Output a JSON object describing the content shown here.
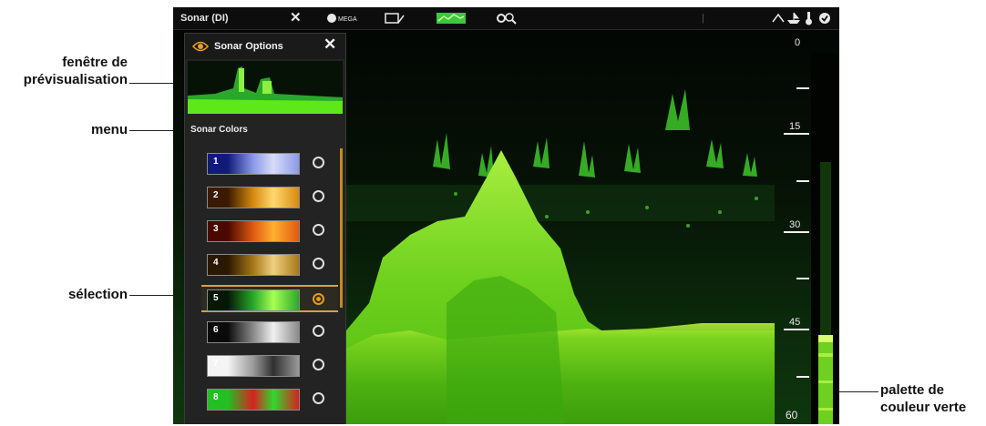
{
  "topbar": {
    "title": "Sonar (DI)",
    "close_glyph": "✕",
    "mega_label": "MEGA",
    "icons": [
      "close-icon",
      "mega-icon",
      "split-view-icon",
      "sonar-view-icon",
      "settings-search-icon",
      "gps-icon",
      "boat-icon",
      "temperature-icon",
      "check-icon"
    ]
  },
  "options": {
    "title": "Sonar Options",
    "close_glyph": "✕",
    "section": "Sonar Colors",
    "palettes": [
      {
        "num": "1",
        "colors": [
          "#101a7a",
          "#8a9ae8",
          "#d8dcf8"
        ],
        "selected": false
      },
      {
        "num": "2",
        "colors": [
          "#3a1a00",
          "#d88a10",
          "#ffd870"
        ],
        "selected": false
      },
      {
        "num": "3",
        "colors": [
          "#4a0800",
          "#e05a10",
          "#ffb030"
        ],
        "selected": false
      },
      {
        "num": "4",
        "colors": [
          "#2a1800",
          "#a87818",
          "#f0d080"
        ],
        "selected": false
      },
      {
        "num": "5",
        "colors": [
          "#051805",
          "#2aa82a",
          "#a8ff50"
        ],
        "selected": true
      },
      {
        "num": "6",
        "colors": [
          "#0a0a0a",
          "#8a8a8a",
          "#f0f0f0"
        ],
        "selected": false
      },
      {
        "num": "7",
        "colors": [
          "#f4f4f4",
          "#9a9a9a",
          "#303030"
        ],
        "selected": false
      },
      {
        "num": "8",
        "colors": [
          "#22c022",
          "#d82020",
          "#30d830"
        ],
        "selected": false
      }
    ]
  },
  "depth_scale": {
    "labels": [
      "0",
      "15",
      "30",
      "45",
      "60"
    ]
  },
  "callouts": {
    "preview_window": "fenêtre de prévisualisation",
    "menu": "menu",
    "selection": "sélection",
    "green_palette": "palette de couleur verte"
  },
  "colors": {
    "accent": "#e89a1a",
    "sonar_green": "#5ee81a",
    "bottom_yellow": "#c8f04a"
  }
}
